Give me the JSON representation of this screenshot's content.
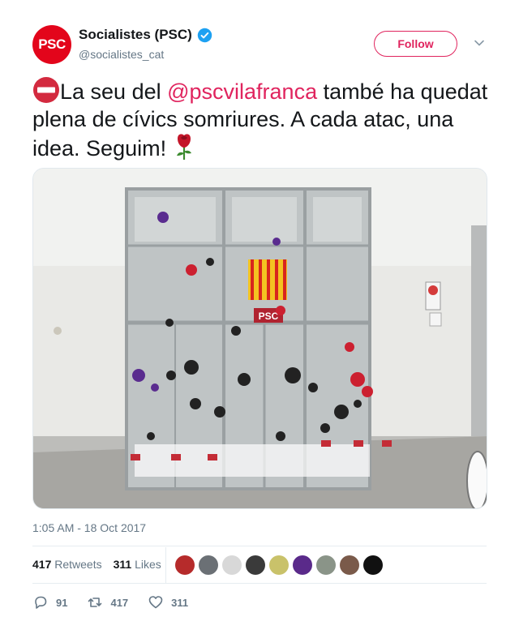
{
  "account": {
    "avatar_text": "PSC",
    "display_name": "Socialistes (PSC)",
    "handle": "@socialistes_cat",
    "verified": true
  },
  "follow_label": "Follow",
  "tweet": {
    "text_before": "La seu del ",
    "mention": "@pscvilafranca",
    "text_after": " també ha quedat plena de cívics somriures. A cada atac, una idea. Seguim! ",
    "leading_emoji": "no-entry-icon",
    "trailing_emoji": "rose-icon"
  },
  "photo": {
    "sign_text": "PSC"
  },
  "timestamp": "1:05 AM - 18 Oct 2017",
  "stats": {
    "retweets_count": "417",
    "retweets_label": "Retweets",
    "likes_count": "311",
    "likes_label": "Likes"
  },
  "actions": {
    "replies": "91",
    "retweets": "417",
    "likes": "311"
  },
  "colors": {
    "accent": "#e0245e",
    "psc_red": "#e3051b",
    "verified": "#1da1f2",
    "muted": "#657786"
  }
}
